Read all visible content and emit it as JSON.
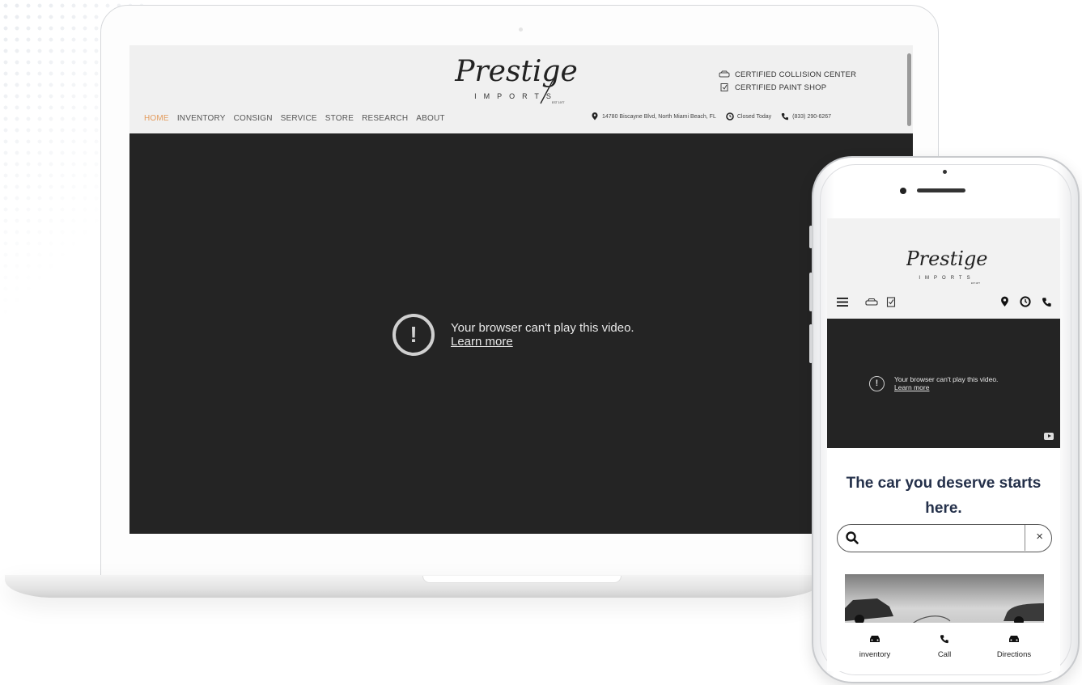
{
  "laptop": {
    "logo": {
      "script": "Prestige",
      "sub": "IMPORTS",
      "est": "EST 1977"
    },
    "certifications": [
      "CERTIFIED COLLISION CENTER",
      "CERTIFIED PAINT SHOP"
    ],
    "nav": [
      {
        "label": "HOME",
        "active": true
      },
      {
        "label": "INVENTORY",
        "active": false
      },
      {
        "label": "CONSIGN",
        "active": false
      },
      {
        "label": "SERVICE",
        "active": false
      },
      {
        "label": "STORE",
        "active": false
      },
      {
        "label": "RESEARCH",
        "active": false
      },
      {
        "label": "ABOUT",
        "active": false
      }
    ],
    "info": {
      "address": "14780 Biscayne Blvd, North Miami Beach, FL",
      "hours": "Closed Today",
      "phone": "(833) 290-6267"
    },
    "video": {
      "message": "Your browser can't play this video.",
      "link": "Learn more"
    }
  },
  "phone": {
    "logo": {
      "script": "Prestige",
      "sub": "IMPORTS",
      "est": "EST 1977"
    },
    "video": {
      "message": "Your browser can't play this video.",
      "link": "Learn more"
    },
    "headline_line1": "The car you deserve starts",
    "headline_line2": "here.",
    "search": {
      "placeholder": "",
      "clear": "×"
    },
    "bottom_nav": [
      {
        "label": "inventory",
        "icon": "car-icon"
      },
      {
        "label": "Call",
        "icon": "phone-icon"
      },
      {
        "label": "Directions",
        "icon": "car-icon"
      }
    ]
  },
  "colors": {
    "accent": "#e39b5c",
    "headline": "#24304a",
    "video_bg": "#242424"
  }
}
